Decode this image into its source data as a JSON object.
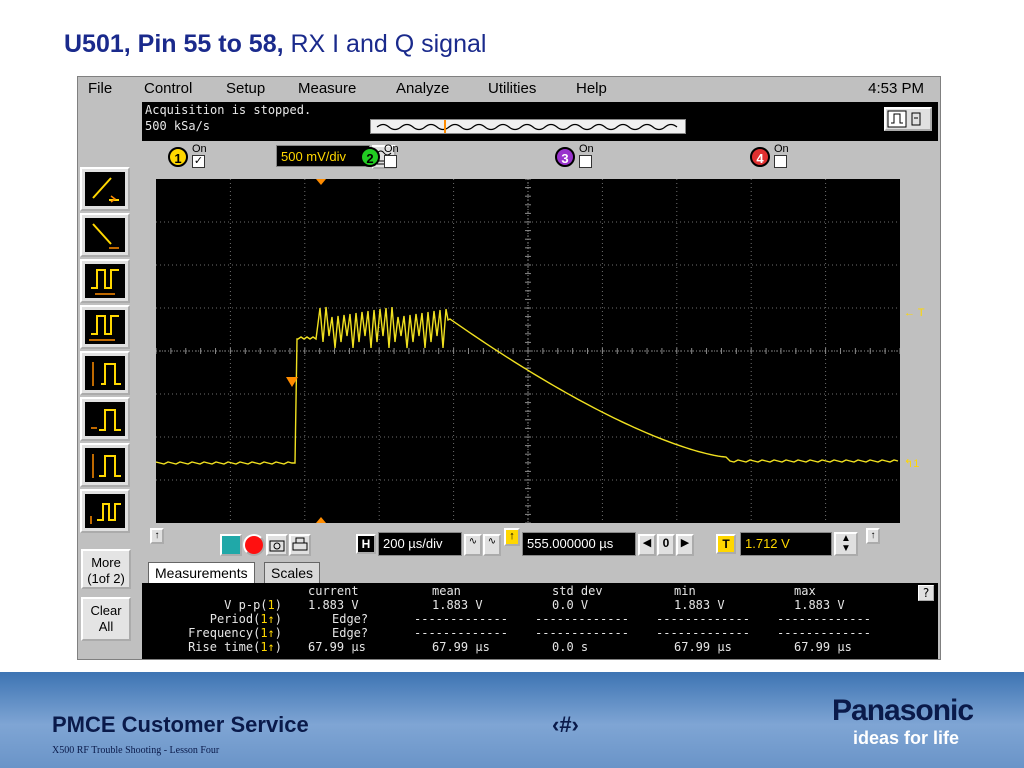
{
  "slide": {
    "title_bold": "U501, Pin 55 to 58,",
    "title_rest": " RX I and Q signal"
  },
  "menu": {
    "items": [
      "File",
      "Control",
      "Setup",
      "Measure",
      "Analyze",
      "Utilities",
      "Help"
    ],
    "clock": "4:53 PM"
  },
  "status": {
    "line1": "Acquisition is stopped.",
    "line2": "500 kSa/s"
  },
  "channels": {
    "on_label": "On",
    "ch1": {
      "number": "1",
      "checked": "✓",
      "scale": "500 mV/div",
      "color": "#ffd700"
    },
    "ch2": {
      "number": "2",
      "color": "#22cc22"
    },
    "ch3": {
      "number": "3",
      "color": "#9933cc"
    },
    "ch4": {
      "number": "4",
      "color": "#e03030"
    }
  },
  "display": {
    "trigger_label": "← T",
    "ground_label": "↰1"
  },
  "sidebar": {
    "more_label": "More\n(1of 2)",
    "clear_label": "Clear\nAll"
  },
  "timebase": {
    "h_label": "H",
    "scale": "200 µs/div",
    "delay": "555.000000 µs",
    "zero_label": "0",
    "t_label": "T",
    "trigger_level": "1.712 V"
  },
  "tabs": {
    "measurements": "Measurements",
    "scales": "Scales"
  },
  "measurements": {
    "help": "?",
    "headers": [
      "current",
      "mean",
      "std dev",
      "min",
      "max"
    ],
    "rows": [
      {
        "label": "V p-p(",
        "ch": "1",
        "suffix": ")",
        "values": [
          "1.883 V",
          "1.883 V",
          "0.0 V",
          "1.883 V",
          "1.883 V"
        ]
      },
      {
        "label": "Period(",
        "ch": "1↑",
        "suffix": ")",
        "values": [
          "Edge?",
          "-------------",
          "-------------",
          "-------------",
          "-------------"
        ]
      },
      {
        "label": "Frequency(",
        "ch": "1↑",
        "suffix": ")",
        "values": [
          "Edge?",
          "-------------",
          "-------------",
          "-------------",
          "-------------"
        ]
      },
      {
        "label": "Rise time(",
        "ch": "1↑",
        "suffix": ")",
        "values": [
          "67.99 µs",
          "67.99 µs",
          "0.0 s",
          "67.99 µs",
          "67.99 µs"
        ]
      }
    ]
  },
  "footer": {
    "title": "PMCE Customer Service",
    "subtitle": "X500 RF Trouble Shooting  -  Lesson Four",
    "slide_num": "‹#›",
    "brand": "Panasonic",
    "tagline": "ideas for life"
  },
  "colors": {
    "trace": "#f0e020",
    "grid": "#6e6e6e",
    "marker": "#ff8c00"
  }
}
